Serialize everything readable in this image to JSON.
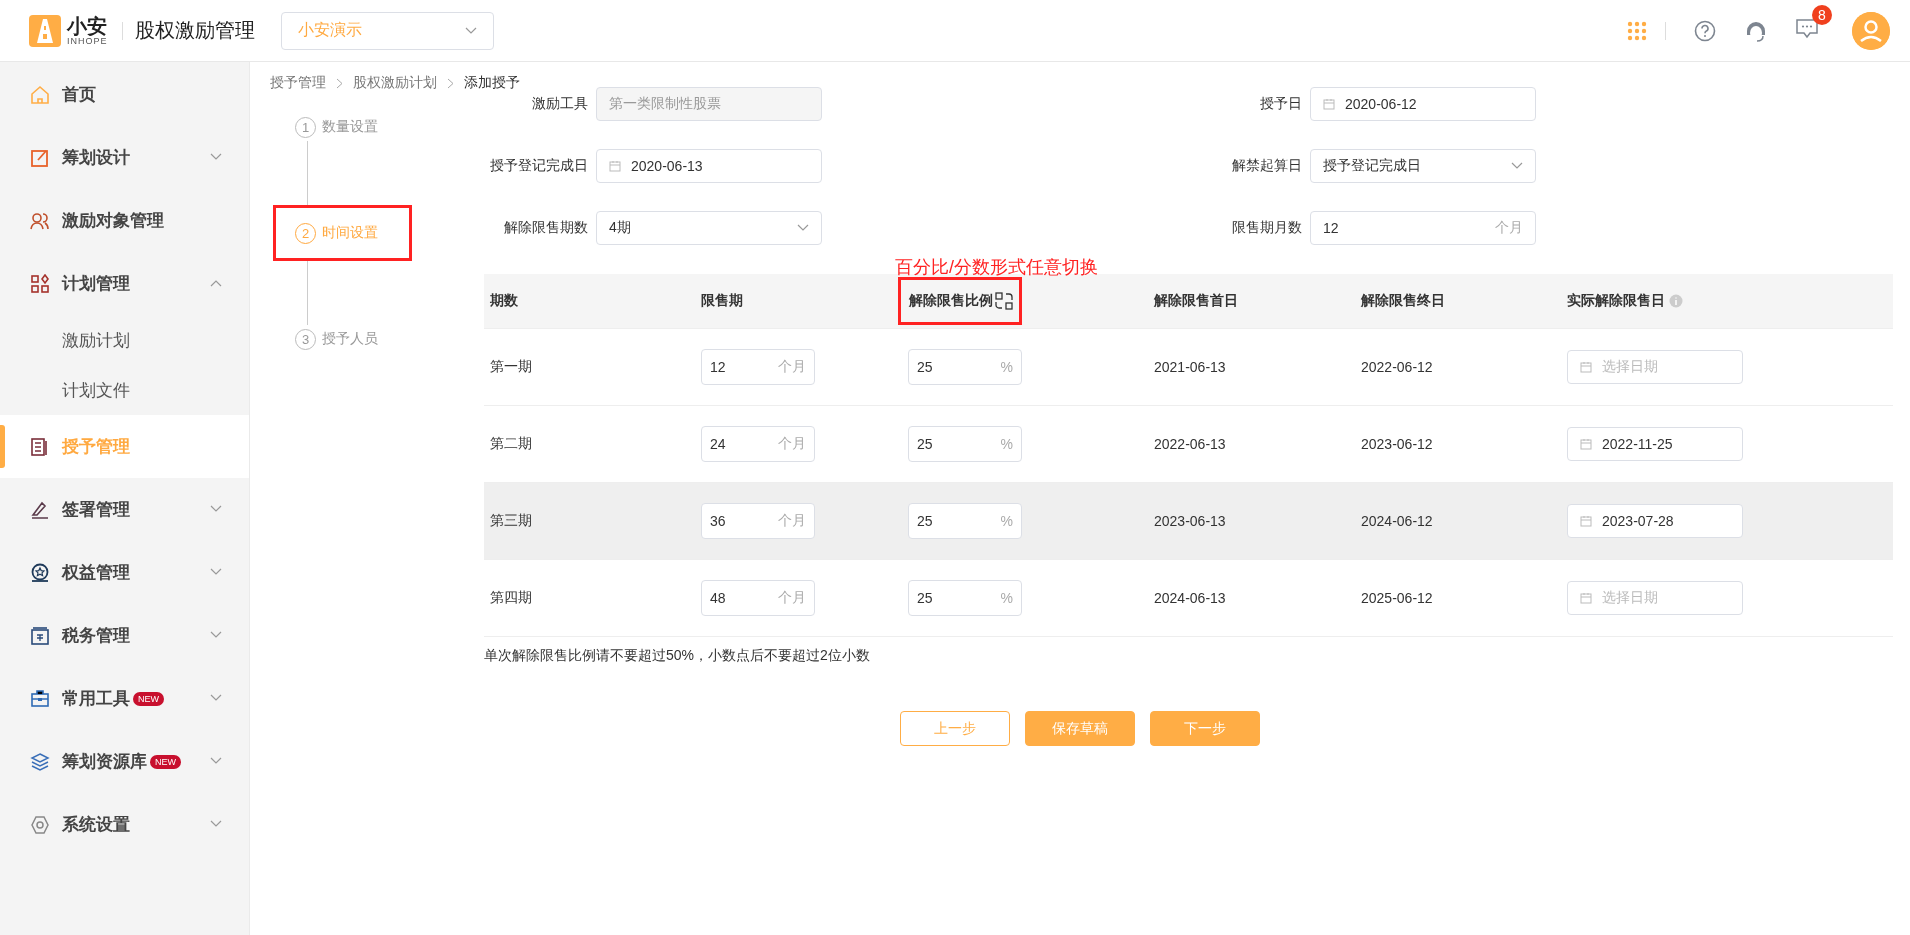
{
  "header": {
    "logo_text": "小安",
    "logo_sub": "INHOPE",
    "app_title": "股权激励管理",
    "org_select": {
      "value": "小安演示"
    },
    "notification_count": "8"
  },
  "sidebar": {
    "items": [
      {
        "label": "首页",
        "kind": "link",
        "selected": false
      },
      {
        "label": "筹划设计",
        "kind": "group",
        "expanded": false,
        "selected": false
      },
      {
        "label": "激励对象管理",
        "kind": "link",
        "selected": false
      },
      {
        "label": "计划管理",
        "kind": "group",
        "expanded": true,
        "selected": false
      },
      {
        "label": "激励计划",
        "kind": "sub",
        "selected": false
      },
      {
        "label": "计划文件",
        "kind": "sub",
        "selected": false
      },
      {
        "label": "授予管理",
        "kind": "link",
        "selected": true
      },
      {
        "label": "签署管理",
        "kind": "group",
        "expanded": false,
        "selected": false
      },
      {
        "label": "权益管理",
        "kind": "group",
        "expanded": false,
        "selected": false
      },
      {
        "label": "税务管理",
        "kind": "group",
        "expanded": false,
        "selected": false
      },
      {
        "label": "常用工具",
        "kind": "group",
        "expanded": false,
        "selected": false,
        "badge": "NEW"
      },
      {
        "label": "筹划资源库",
        "kind": "group",
        "expanded": false,
        "selected": false,
        "badge": "NEW"
      },
      {
        "label": "系统设置",
        "kind": "group",
        "expanded": false,
        "selected": false
      }
    ]
  },
  "breadcrumb": [
    "授予管理",
    "股权激励计划",
    "添加授予"
  ],
  "steps": [
    {
      "number": "1",
      "label": "数量设置",
      "selected": false,
      "highlighted": false
    },
    {
      "number": "2",
      "label": "时间设置",
      "selected": true,
      "highlighted": true
    },
    {
      "number": "3",
      "label": "授予人员",
      "selected": false,
      "highlighted": false
    }
  ],
  "form": {
    "rows": [
      [
        {
          "label": "激励工具",
          "kind": "readonly",
          "disabled": true,
          "value": "第一类限制性股票"
        },
        {
          "label": "授予日",
          "kind": "date",
          "value": "2020-06-12"
        }
      ],
      [
        {
          "label": "授予登记完成日",
          "kind": "date",
          "value": "2020-06-13"
        },
        {
          "label": "解禁起算日",
          "kind": "select",
          "value": "授予登记完成日"
        }
      ],
      [
        {
          "label": "解除限售期数",
          "kind": "select",
          "value": "4期"
        },
        {
          "label": "限售期月数",
          "kind": "unit",
          "value": "12",
          "unit": "个月"
        }
      ]
    ]
  },
  "annotation": "百分比/分数形式任意切换",
  "table": {
    "columns": [
      {
        "label": "期数",
        "highlighted": false
      },
      {
        "label": "限售期",
        "highlighted": false
      },
      {
        "label": "解除限售比例",
        "highlighted": true,
        "switch_icon": true
      },
      {
        "label": "解除限售首日",
        "highlighted": false
      },
      {
        "label": "解除限售终日",
        "highlighted": false
      },
      {
        "label": "实际解除限售日",
        "highlighted": false,
        "info_icon": true
      }
    ],
    "rows": [
      {
        "period": "第一期",
        "months": "12",
        "months_unit": "个月",
        "ratio": "25",
        "ratio_unit": "%",
        "first_day": "2021-06-13",
        "last_day": "2022-06-12",
        "actual": {
          "placeholder": "选择日期"
        },
        "hovered": false
      },
      {
        "period": "第二期",
        "months": "24",
        "months_unit": "个月",
        "ratio": "25",
        "ratio_unit": "%",
        "first_day": "2022-06-13",
        "last_day": "2023-06-12",
        "actual": {
          "value": "2022-11-25"
        },
        "hovered": false
      },
      {
        "period": "第三期",
        "months": "36",
        "months_unit": "个月",
        "ratio": "25",
        "ratio_unit": "%",
        "first_day": "2023-06-13",
        "last_day": "2024-06-12",
        "actual": {
          "value": "2023-07-28"
        },
        "hovered": true
      },
      {
        "period": "第四期",
        "months": "48",
        "months_unit": "个月",
        "ratio": "25",
        "ratio_unit": "%",
        "first_day": "2024-06-13",
        "last_day": "2025-06-12",
        "actual": {
          "placeholder": "选择日期"
        },
        "hovered": false
      }
    ]
  },
  "note": "单次解除限售比例请不要超过50%，小数点后不要超过2位小数",
  "buttons": [
    {
      "label": "上一步",
      "kind": "secondary"
    },
    {
      "label": "保存草稿",
      "kind": "primary"
    },
    {
      "label": "下一步",
      "kind": "primary"
    }
  ]
}
